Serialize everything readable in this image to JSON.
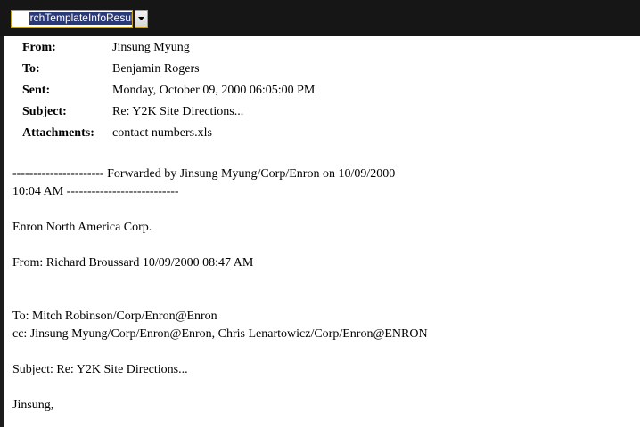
{
  "toolbar": {
    "dropdown_value": "rchTemplateInfoResult"
  },
  "email": {
    "headers": [
      {
        "label": "From:",
        "value": "Jinsung Myung"
      },
      {
        "label": "To:",
        "value": "Benjamin Rogers"
      },
      {
        "label": "Sent:",
        "value": "Monday, October 09, 2000 06:05:00 PM"
      },
      {
        "label": "Subject:",
        "value": "Re: Y2K Site Directions..."
      },
      {
        "label": "Attachments:",
        "value": "contact numbers.xls"
      }
    ],
    "body": {
      "forward_line_1": "---------------------- Forwarded by Jinsung Myung/Corp/Enron on 10/09/2000",
      "forward_line_2": "10:04 AM ---------------------------",
      "company": "Enron North America Corp.",
      "from": "From: Richard Broussard 10/09/2000 08:47 AM",
      "to": "To: Mitch Robinson/Corp/Enron@Enron",
      "cc": "cc: Jinsung Myung/Corp/Enron@Enron, Chris Lenartowicz/Corp/Enron@ENRON",
      "subject": "Subject: Re: Y2K Site Directions...",
      "greeting": "Jinsung,"
    }
  }
}
